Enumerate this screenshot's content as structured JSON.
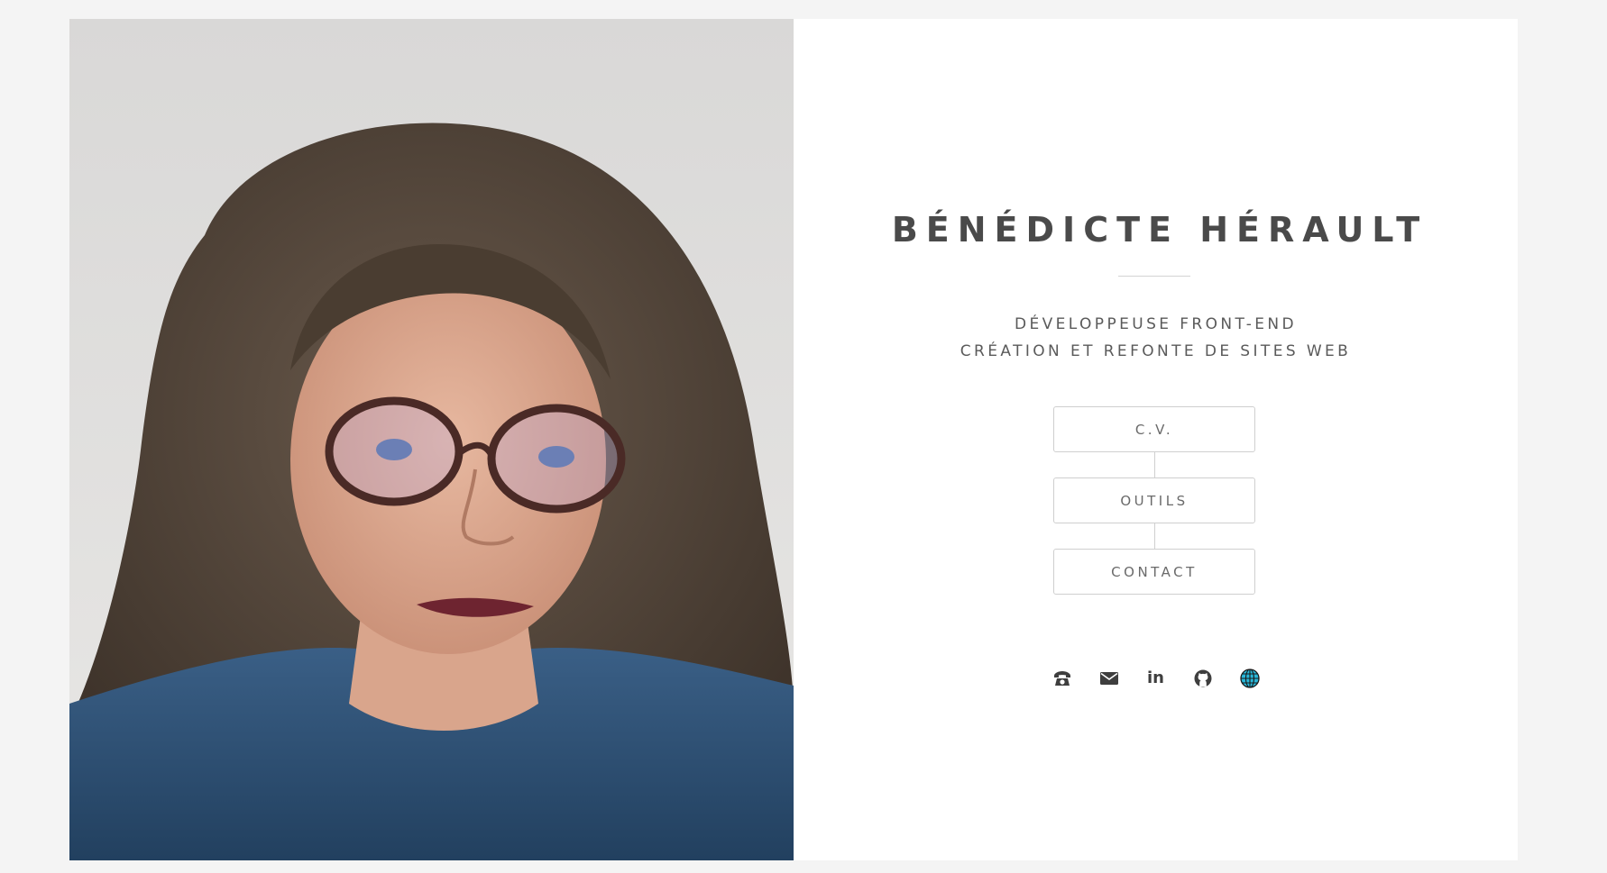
{
  "profile": {
    "name": "BÉNÉDICTE HÉRAULT",
    "tagline_line1": "DÉVELOPPEUSE FRONT-END",
    "tagline_line2": "CRÉATION ET REFONTE DE SITES WEB"
  },
  "nav": {
    "cv_label": "C.V.",
    "tools_label": "OUTILS",
    "contact_label": "CONTACT"
  },
  "social": {
    "linkedin_label": "in",
    "icons": [
      "phone-icon",
      "envelope-icon",
      "linkedin-icon",
      "github-icon",
      "globe-icon"
    ]
  },
  "colors": {
    "page_background": "#f4f4f4",
    "card_background": "#ffffff",
    "heading": "#4a4a4a",
    "button_border": "#cfcfcf",
    "globe_accent": "#29b6d8"
  }
}
